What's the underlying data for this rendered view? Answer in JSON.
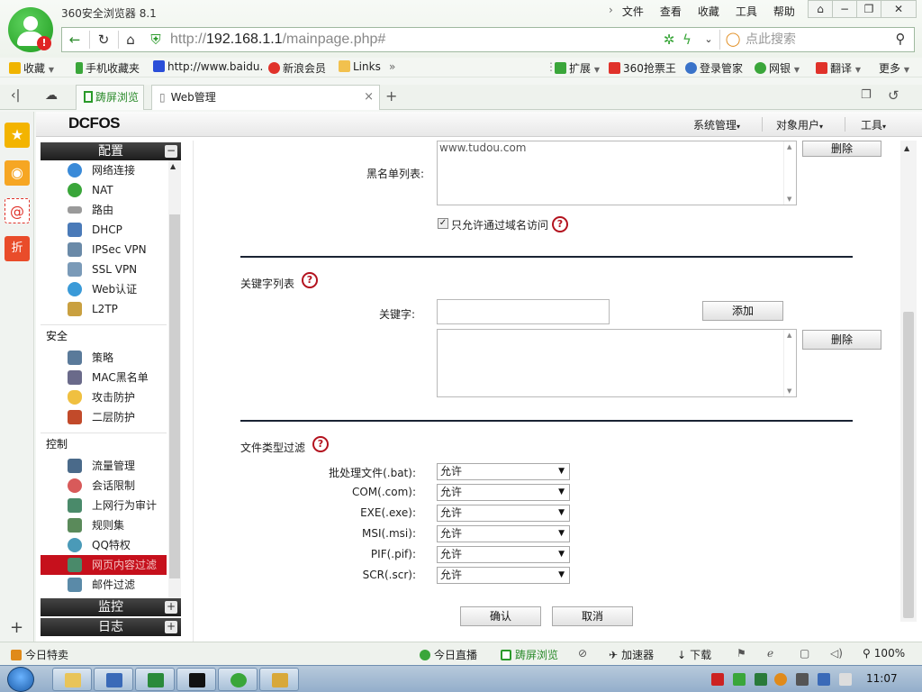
{
  "browser": {
    "title": "360安全浏览器 8.1",
    "menu": [
      "文件",
      "查看",
      "收藏",
      "工具",
      "帮助"
    ],
    "url_prefix": "http://",
    "url_host": "192.168.1.1",
    "url_path": "/mainpage.php#",
    "search_placeholder": "点此搜索"
  },
  "bookmarks": {
    "left": [
      {
        "label": "收藏",
        "icon": "star-icon",
        "color": "#f0b400"
      },
      {
        "label": "手机收藏夹",
        "icon": "phone-icon",
        "color": "#3aa63a"
      },
      {
        "label": "http://www.baidu.",
        "icon": "paw-icon",
        "color": "#2a4ed8"
      },
      {
        "label": "新浪会员",
        "icon": "weibo-icon",
        "color": "#e0322a"
      },
      {
        "label": "Links",
        "icon": "folder-icon",
        "color": "#f2c14e"
      }
    ],
    "right": [
      {
        "label": "扩展",
        "icon": "extension-icon",
        "color": "#3aa63a"
      },
      {
        "label": "360抢票王",
        "icon": "ticket-icon",
        "color": "#e0322a"
      },
      {
        "label": "登录管家",
        "icon": "key-icon",
        "color": "#3a73c9"
      },
      {
        "label": "网银",
        "icon": "bank-icon",
        "color": "#3aa63a"
      },
      {
        "label": "翻译",
        "icon": "translate-icon",
        "color": "#e0322a"
      },
      {
        "label": "更多",
        "icon": "more-icon",
        "color": "#666666"
      }
    ]
  },
  "tabs": {
    "split_label": "踌屏浏览",
    "active_label": "Web管理"
  },
  "app": {
    "brand": "DCFOS",
    "menus": [
      "系统管理",
      "对象用户",
      "工具"
    ]
  },
  "sidebar": {
    "config_header": "配置",
    "config_items": [
      "网络连接",
      "NAT",
      "路由",
      "DHCP",
      "IPSec VPN",
      "SSL VPN",
      "Web认证",
      "L2TP"
    ],
    "security_group": "安全",
    "security_items": [
      "策略",
      "MAC黑名单",
      "攻击防护",
      "二层防护"
    ],
    "control_group": "控制",
    "control_items": [
      "流量管理",
      "会话限制",
      "上网行为审计",
      "规则集",
      "QQ特权",
      "网页内容过滤",
      "邮件过滤"
    ],
    "selected": "网页内容过滤",
    "monitor_header": "监控",
    "log_header": "日志"
  },
  "form": {
    "blacklist_label": "黑名单列表:",
    "blacklist_items": [
      "www.tudou.com"
    ],
    "delete_label": "删除",
    "domain_only_label": "只允许通过域名访问",
    "domain_only_checked": true,
    "keyword_section": "关键字列表",
    "keyword_label": "关键字:",
    "keyword_value": "",
    "add_label": "添加",
    "keyword_list": [],
    "filetype_section": "文件类型过滤",
    "filetypes": [
      {
        "label": "批处理文件(.bat):",
        "value": "允许"
      },
      {
        "label": "COM(.com):",
        "value": "允许"
      },
      {
        "label": "EXE(.exe):",
        "value": "允许"
      },
      {
        "label": "MSI(.msi):",
        "value": "允许"
      },
      {
        "label": "PIF(.pif):",
        "value": "允许"
      },
      {
        "label": "SCR(.scr):",
        "value": "允许"
      }
    ],
    "confirm_label": "确认",
    "cancel_label": "取消"
  },
  "statusbar": {
    "left": "今日特卖",
    "items": [
      "今日直播",
      "踌屏浏览",
      "加速器",
      "下载"
    ],
    "zoom": "100%"
  },
  "taskbar": {
    "clock": "11:07"
  }
}
